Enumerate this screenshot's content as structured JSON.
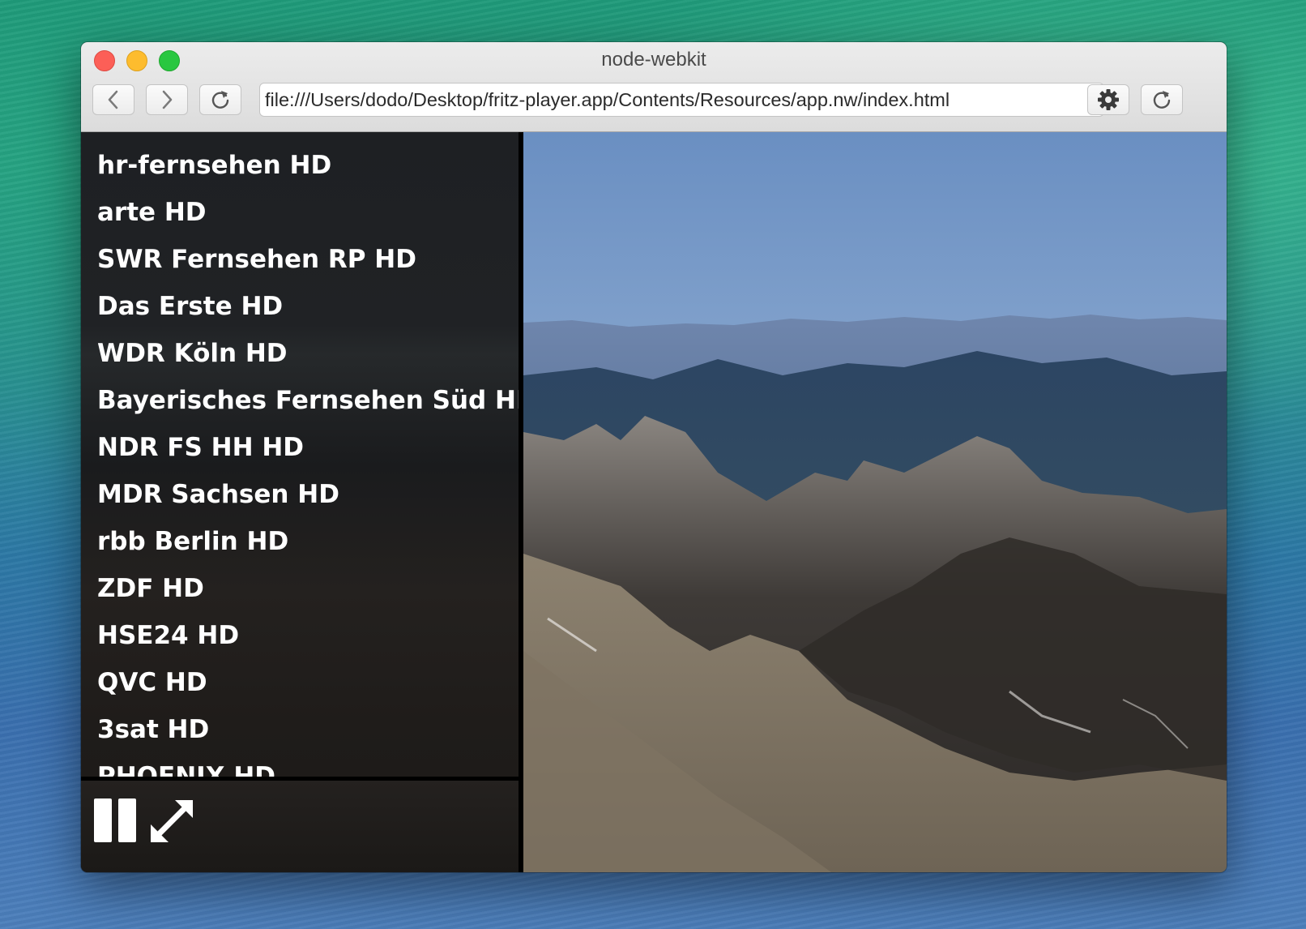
{
  "window": {
    "title": "node-webkit"
  },
  "toolbar": {
    "url": "file:///Users/dodo/Desktop/fritz-player.app/Contents/Resources/app.nw/index.html",
    "icons": [
      "chevron-left-icon",
      "chevron-right-icon",
      "reload-icon",
      "gear-icon",
      "reload-icon"
    ]
  },
  "sidebar": {
    "channels": [
      "hr-fernsehen HD",
      "arte HD",
      "SWR Fernsehen RP HD",
      "Das Erste HD",
      "WDR Köln HD",
      "Bayerisches Fernsehen Süd HD",
      "NDR FS HH HD",
      "MDR Sachsen HD",
      "rbb Berlin HD",
      "ZDF HD",
      "HSE24 HD",
      "QVC HD",
      "3sat HD",
      "PHOENIX HD"
    ]
  },
  "player": {
    "controls": [
      "pause-icon",
      "fullscreen-icon"
    ]
  },
  "colors": {
    "traffic_close": "#fc5f57",
    "traffic_minimize": "#fdbc2e",
    "traffic_maximize": "#29c740",
    "channel_text": "#ffffff"
  }
}
